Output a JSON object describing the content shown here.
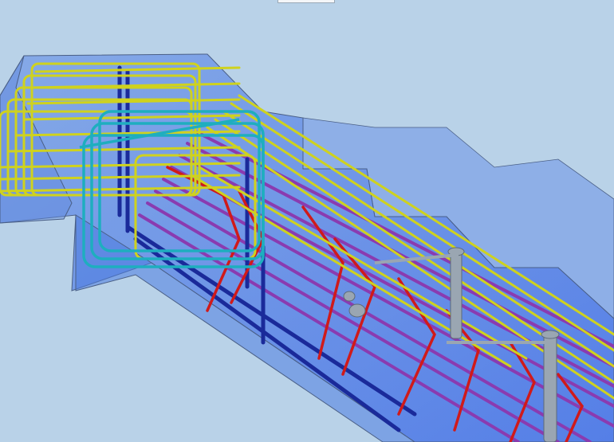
{
  "scene": {
    "background": "#b9d2e8",
    "concrete_fill": "#1f5ae8",
    "concrete_edge": "#4a5f86",
    "rebar_colors": {
      "longitudinal_yellow": "#cfd21e",
      "stirrup_cyan": "#1eaebf",
      "main_blue": "#1a2a9a",
      "bottom_purple": "#8a3bb0",
      "cross_red": "#d01a1a",
      "fitting_grey": "#9aa6b2"
    }
  }
}
